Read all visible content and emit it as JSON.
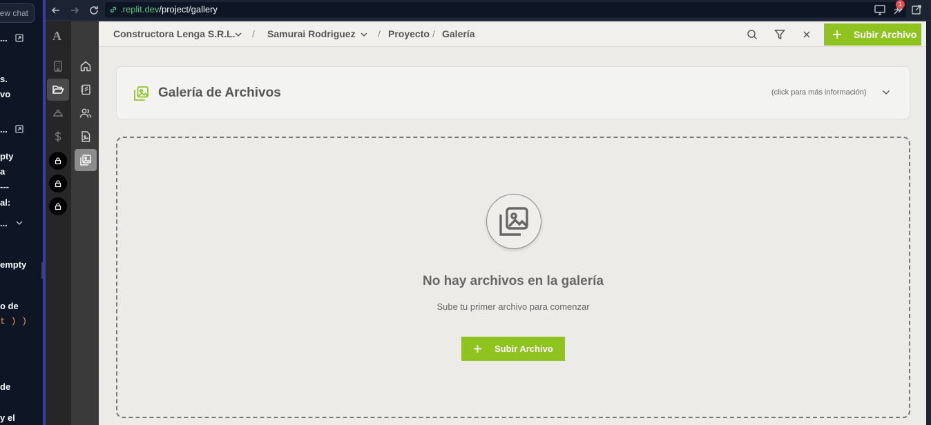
{
  "chat": {
    "new_chat": "ew chat",
    "fragments": [
      "...",
      "s.",
      "vo",
      "...",
      "pty",
      "a",
      "---",
      "al:",
      "...",
      "empty",
      "o de",
      "t ) )",
      "de",
      "y el"
    ]
  },
  "browser": {
    "url_host": ".replit.dev",
    "url_path": "/project/gallery",
    "notification_count": "1"
  },
  "app": {
    "logo": "A",
    "breadcrumb": {
      "company": "Constructora Lenga S.R.L.",
      "client": "Samurai Rodriguez",
      "section": "Proyecto",
      "page": "Galería",
      "separator": "/"
    },
    "upload_label": "Subir Archivo",
    "info_card": {
      "title": "Galería de Archivos",
      "hint": "(click para más información)"
    },
    "empty_state": {
      "title": "No hay archivos en la galería",
      "subtitle": "Sube tu primer archivo para comenzar",
      "button": "Subir Archivo"
    }
  },
  "colors": {
    "accent": "#8fc31f",
    "rail_dark": "#262626",
    "rail_mid": "#3a3a3a",
    "main_bg": "#ecebe7"
  },
  "icons": {
    "rail1": [
      "building-icon",
      "folder-open-icon",
      "hard-hat-icon",
      "dollar-icon",
      "lock-icon",
      "lock-icon",
      "lock-icon"
    ],
    "rail2": [
      "home-icon",
      "notebook-icon",
      "users-icon",
      "file-image-icon",
      "gallery-icon"
    ]
  }
}
